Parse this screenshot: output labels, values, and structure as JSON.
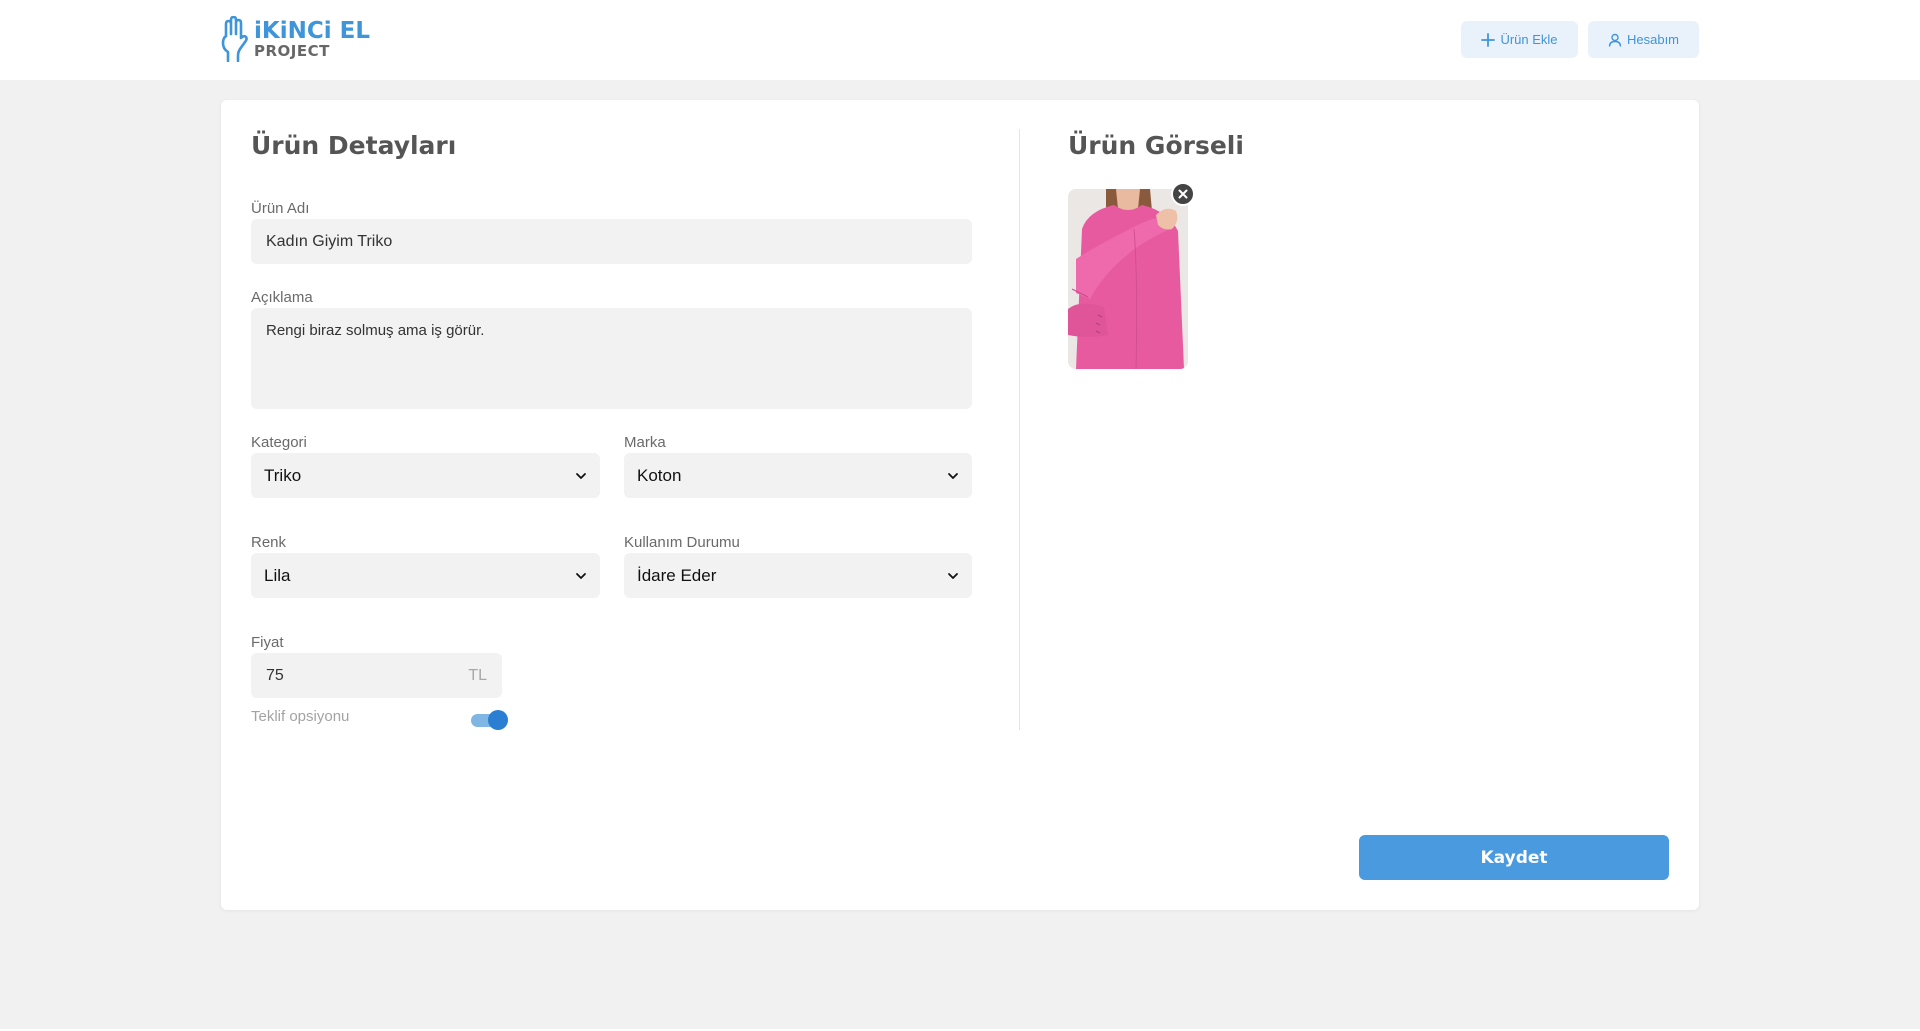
{
  "brand": {
    "logo_top": "iKiNCi EL",
    "logo_bottom": "PROJECT"
  },
  "header": {
    "add_product_label": "Ürün Ekle",
    "account_label": "Hesabım"
  },
  "details": {
    "title": "Ürün Detayları",
    "name_label": "Ürün Adı",
    "name_value": "Kadın Giyim Triko",
    "description_label": "Açıklama",
    "description_value": "Rengi biraz solmuş ama iş görür.",
    "category_label": "Kategori",
    "category_value": "Triko",
    "brand_label": "Marka",
    "brand_value": "Koton",
    "color_label": "Renk",
    "color_value": "Lila",
    "condition_label": "Kullanım Durumu",
    "condition_value": "İdare Eder",
    "price_label": "Fiyat",
    "price_value": "75",
    "price_unit": "TL",
    "offer_label": "Teklif opsiyonu",
    "offer_enabled": true
  },
  "image_section": {
    "title": "Ürün Görseli",
    "image_alt": "pink-sweater-photo"
  },
  "actions": {
    "save_label": "Kaydet"
  },
  "colors": {
    "accent": "#4a9ae0",
    "accent_light": "#e9f2fa",
    "field_bg": "#f2f2f2",
    "page_bg": "#f1f1f1"
  }
}
